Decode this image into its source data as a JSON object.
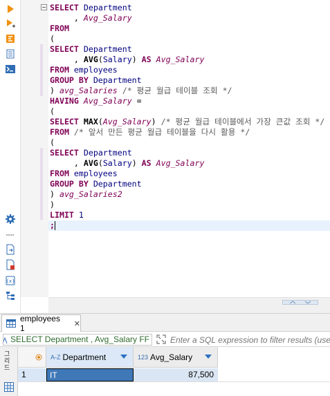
{
  "editor": {
    "lines": [
      [
        [
          "kw",
          "SELECT "
        ],
        [
          "id",
          "Department"
        ]
      ],
      [
        [
          "pn",
          "     , "
        ],
        [
          "al",
          "Avg_Salary"
        ]
      ],
      [
        [
          "kw",
          "FROM"
        ]
      ],
      [
        [
          "pn",
          "("
        ]
      ],
      [
        [
          "kw",
          "SELECT "
        ],
        [
          "id",
          "Department"
        ]
      ],
      [
        [
          "pn",
          "     , "
        ],
        [
          "fn",
          "AVG"
        ],
        [
          "pn",
          "("
        ],
        [
          "id",
          "Salary"
        ],
        [
          "pn",
          ") "
        ],
        [
          "kw",
          "AS "
        ],
        [
          "al",
          "Avg_Salary"
        ]
      ],
      [
        [
          "kw",
          "FROM "
        ],
        [
          "id",
          "employees"
        ]
      ],
      [
        [
          "kw",
          "GROUP BY "
        ],
        [
          "id",
          "Department"
        ]
      ],
      [
        [
          "pn",
          ") "
        ],
        [
          "al",
          "avg_Salaries "
        ],
        [
          "cm",
          "/* 평균 월급 테이블 조회 */"
        ]
      ],
      [
        [
          "kw",
          "HAVING "
        ],
        [
          "al",
          "Avg_Salary "
        ],
        [
          "pn",
          "="
        ]
      ],
      [
        [
          "pn",
          "("
        ]
      ],
      [
        [
          "kw",
          "SELECT "
        ],
        [
          "fn",
          "MAX"
        ],
        [
          "pn",
          "("
        ],
        [
          "al",
          "Avg_Salary"
        ],
        [
          "pn",
          ") "
        ],
        [
          "cm",
          "/* 평균 월급 테이블에서 가장 큰값 조회 */"
        ]
      ],
      [
        [
          "kw",
          "FROM "
        ],
        [
          "cm",
          "/* 앞서 만든 평균 월급 테이블을 다시 활용 */"
        ]
      ],
      [
        [
          "pn",
          "("
        ]
      ],
      [
        [
          "kw",
          "SELECT "
        ],
        [
          "id",
          "Department"
        ]
      ],
      [
        [
          "pn",
          "     , "
        ],
        [
          "fn",
          "AVG"
        ],
        [
          "pn",
          "("
        ],
        [
          "id",
          "Salary"
        ],
        [
          "pn",
          ") "
        ],
        [
          "kw",
          "AS "
        ],
        [
          "al",
          "Avg_Salary"
        ]
      ],
      [
        [
          "kw",
          "FROM "
        ],
        [
          "id",
          "employees"
        ]
      ],
      [
        [
          "kw",
          "GROUP BY "
        ],
        [
          "id",
          "Department"
        ]
      ],
      [
        [
          "pn",
          ") "
        ],
        [
          "al",
          "avg_Salaries2"
        ]
      ],
      [
        [
          "pn",
          ")"
        ]
      ],
      [
        [
          "kw",
          "LIMIT "
        ],
        [
          "num",
          "1"
        ]
      ],
      [
        [
          "kw",
          ";"
        ]
      ]
    ]
  },
  "results": {
    "tab_label": "employees 1",
    "tab_close": "✕",
    "filter_query": "SELECT Department , Avg_Salary FF",
    "filter_placeholder": "Enter a SQL expression to filter results (use",
    "columns": [
      {
        "type": "A-Z",
        "name": "Department"
      },
      {
        "type": "123",
        "name": "Avg_Salary"
      }
    ],
    "rows": [
      {
        "num": "1",
        "Department": "IT",
        "Avg_Salary": "87,500"
      }
    ],
    "side_label": "그리드"
  },
  "colors": {
    "keyword": "#7f0055",
    "identifier": "#000080",
    "accent": "#2b70c0"
  }
}
